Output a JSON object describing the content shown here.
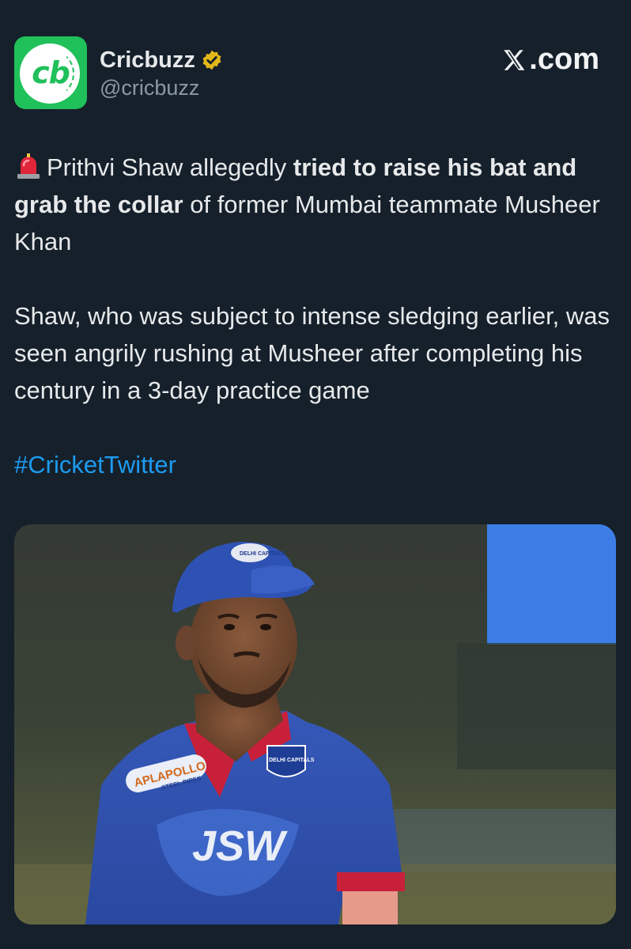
{
  "account": {
    "display_name": "Cricbuzz",
    "handle": "@cricbuzz",
    "avatar_text": "cb",
    "verified": true,
    "verified_color": "#e2b719"
  },
  "site": {
    "label": ".com",
    "logo_icon": "x-logo-icon"
  },
  "tweet": {
    "emoji_icon": "siren-emoji-icon",
    "p1_a": "Prithvi Shaw allegedly ",
    "p1_b": "tried to raise his bat and grab the collar",
    "p1_c": " of former Mumbai teammate Musheer Khan",
    "p2": "Shaw, who was subject to intense sledging earlier, was seen angrily rushing at Musheer after completing his century in a 3-day practice game",
    "hashtag": "#CricketTwitter"
  },
  "photo": {
    "jersey_sponsor": "JSW",
    "chest_sponsor": "APLAPOLLO",
    "chest_sponsor_sub": "STEEL PIPES",
    "team_badge": "DELHI CAPITALS",
    "cap_badge": "DELHI CAPITALS"
  },
  "colors": {
    "background": "#15202b",
    "text": "#e7e9ea",
    "muted": "#8b98a5",
    "link": "#1d9bf0",
    "brand_green": "#20c05a",
    "jersey_blue": "#2f4fae",
    "jersey_red": "#c8203a"
  }
}
